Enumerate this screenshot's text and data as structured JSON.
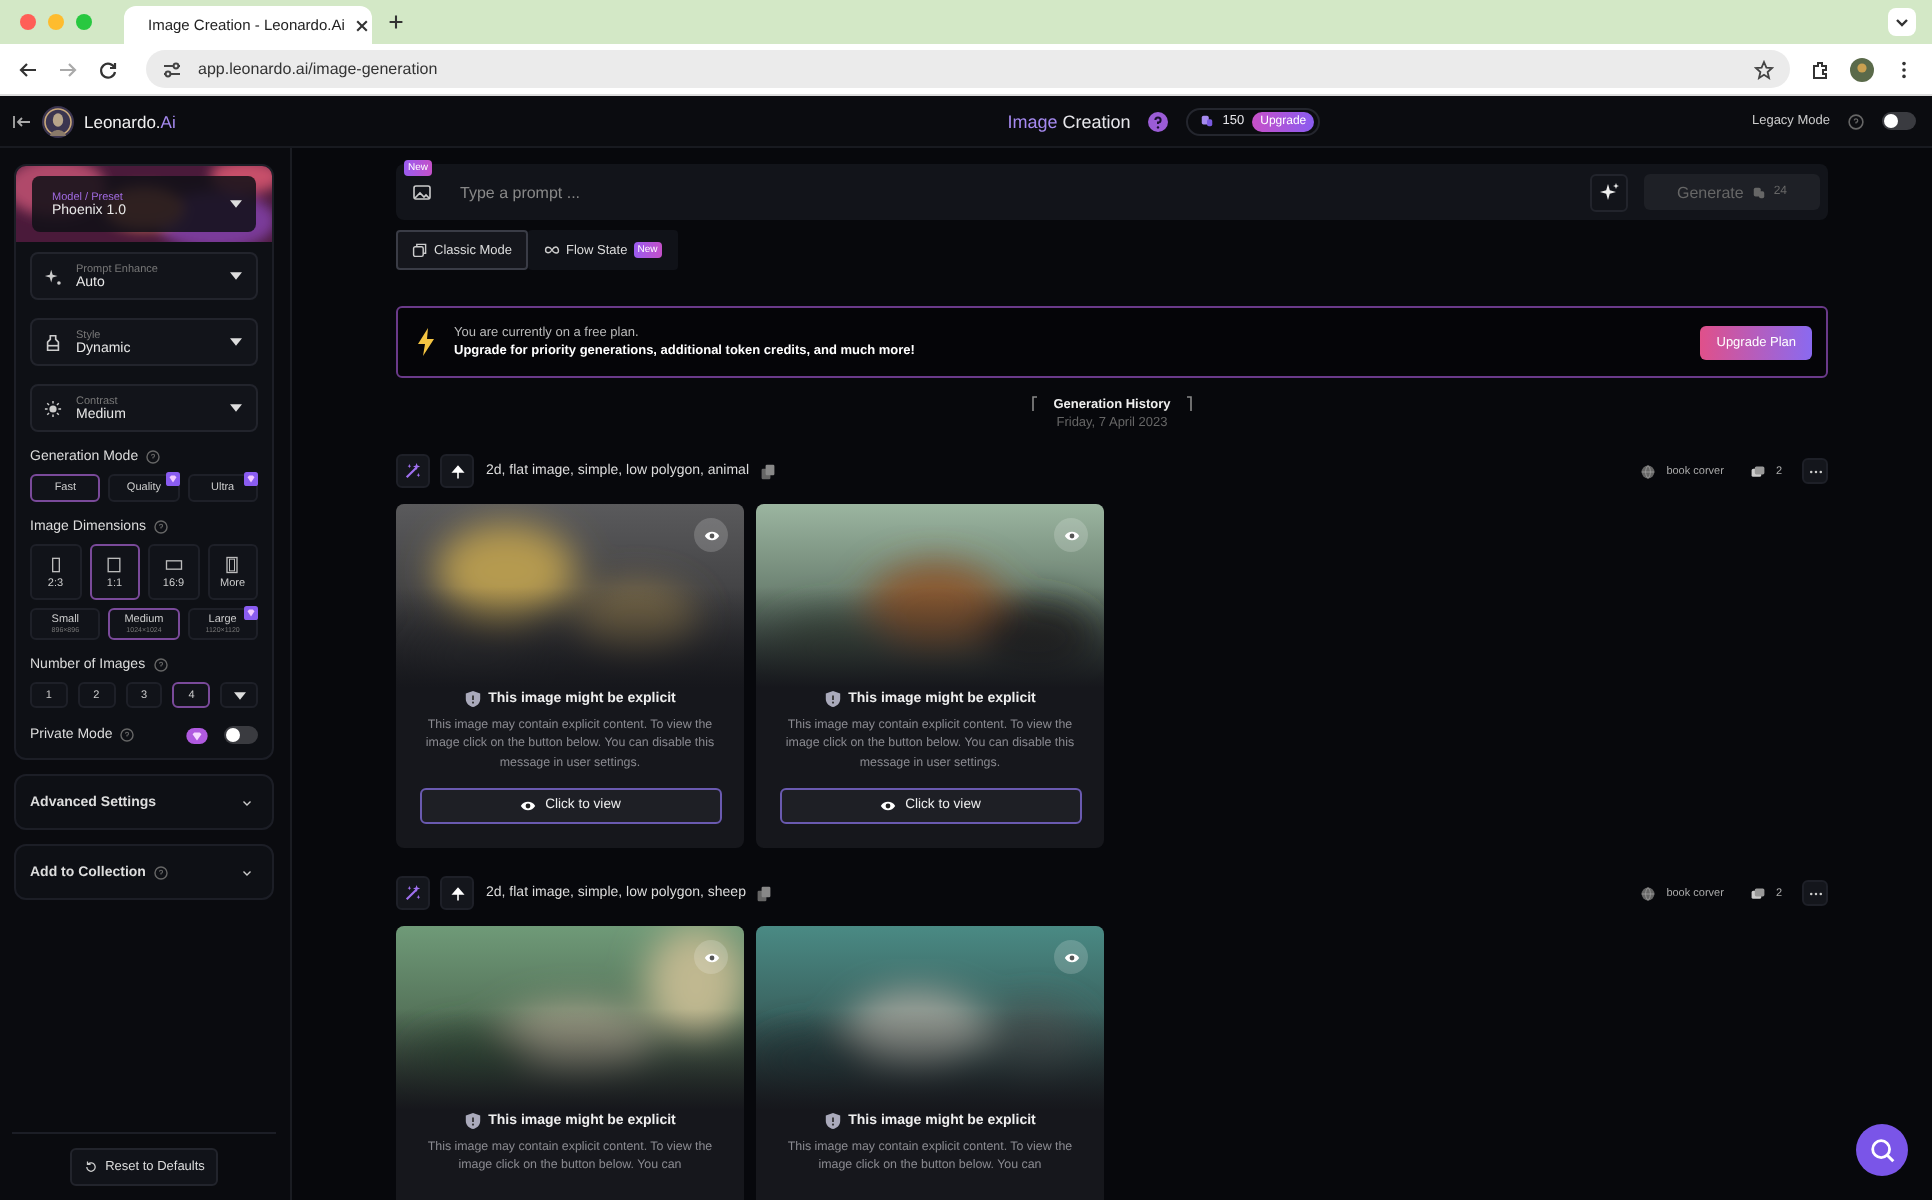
{
  "browser": {
    "tab_title": "Image Creation - Leonardo.Ai",
    "url": "app.leonardo.ai/image-generation"
  },
  "header": {
    "brand": "Leonardo.*Ai*",
    "title": "*Image* Creation",
    "credits": "150",
    "upgrade": "Upgrade",
    "legacy_mode": {
      "label": "Legacy Mode",
      "on": false
    }
  },
  "sidebar": {
    "model": {
      "label": "Model / Preset",
      "value": "Phoenix 1.0"
    },
    "selects": [
      {
        "label": "Prompt Enhance",
        "value": "Auto"
      },
      {
        "label": "Style",
        "value": "Dynamic"
      },
      {
        "label": "Contrast",
        "value": "Medium"
      }
    ],
    "generation_mode": {
      "label": "Generation Mode",
      "options": [
        {
          "label": "Fast",
          "selected": true,
          "premium": false
        },
        {
          "label": "Quality",
          "selected": false,
          "premium": true
        },
        {
          "label": "Ultra",
          "selected": false,
          "premium": true
        }
      ]
    },
    "image_dimensions": {
      "label": "Image Dimensions",
      "ratios": [
        {
          "label": "2:3",
          "selected": false
        },
        {
          "label": "1:1",
          "selected": true
        },
        {
          "label": "16:9",
          "selected": false
        },
        {
          "label": "More",
          "selected": false
        }
      ],
      "sizes": [
        {
          "label": "Small",
          "resolution": "896×896",
          "selected": false,
          "premium": false
        },
        {
          "label": "Medium",
          "resolution": "1024×1024",
          "selected": true,
          "premium": false
        },
        {
          "label": "Large",
          "resolution": "1120×1120",
          "selected": false,
          "premium": true
        }
      ]
    },
    "number_of_images": {
      "label": "Number of Images",
      "options": [
        {
          "label": "1",
          "selected": false
        },
        {
          "label": "2",
          "selected": false
        },
        {
          "label": "3",
          "selected": false
        },
        {
          "label": "4",
          "selected": true
        }
      ]
    },
    "private_mode": {
      "label": "Private Mode",
      "on": false
    },
    "sections": [
      {
        "label": "Advanced Settings",
        "help": false
      },
      {
        "label": "Add to Collection",
        "help": true
      }
    ],
    "reset": "Reset to Defaults"
  },
  "prompt": {
    "badge": "New",
    "placeholder": "Type a prompt ...",
    "generate": "Generate",
    "cost": "24",
    "generate_disabled": true
  },
  "modes": [
    {
      "label": "Classic Mode",
      "selected": true
    },
    {
      "label": "Flow State",
      "selected": false,
      "badge": "New"
    }
  ],
  "banner": {
    "line1": "You are currently on a free plan.",
    "line2": "Upgrade for priority generations, additional token credits, and much more!",
    "button": "Upgrade Plan"
  },
  "history": {
    "title": "Generation History",
    "date": "Friday, 7 April 2023"
  },
  "generations": [
    {
      "prompt": "2d, flat image, simple, low polygon, animal",
      "tag": "book corver",
      "count": "2",
      "images": [
        {
          "kind": "picture",
          "warning": "This image might be explicit",
          "description": "This image may contain explicit content. To view the image click on the button below. You can disable this message in user settings.",
          "button": "Click to view"
        },
        {
          "kind": "picture",
          "warning": "This image might be explicit",
          "description": "This image may contain explicit content. To view the image click on the button below. You can disable this message in user settings.",
          "button": "Click to view"
        }
      ]
    },
    {
      "prompt": "2d, flat image, simple, low polygon, sheep",
      "tag": "book corver",
      "count": "2",
      "images": [
        {
          "kind": "picture",
          "warning": "This image might be explicit",
          "description": "This image may contain explicit content. To view the image click on the button below. You can"
        },
        {
          "kind": "picture",
          "warning": "This image might be explicit",
          "description": "This image may contain explicit content. To view the image click on the button below. You can"
        }
      ]
    }
  ]
}
